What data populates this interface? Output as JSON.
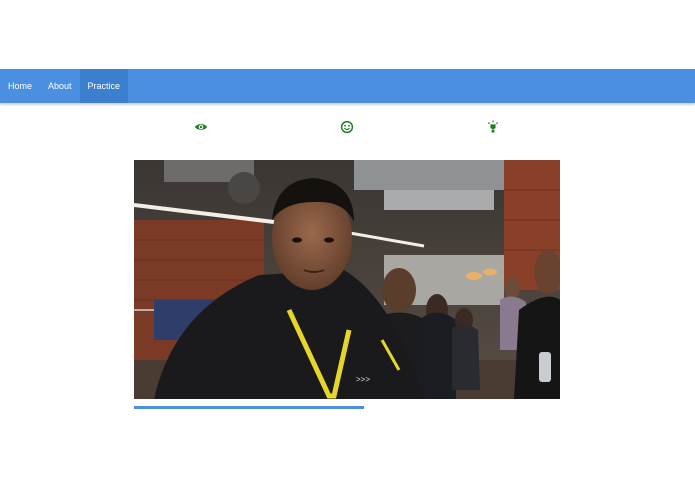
{
  "nav": {
    "items": [
      {
        "label": "Home",
        "active": false
      },
      {
        "label": "About",
        "active": false
      },
      {
        "label": "Practice",
        "active": true
      }
    ]
  },
  "toolbar": {
    "icons": [
      {
        "name": "eye-icon"
      },
      {
        "name": "smiley-icon"
      },
      {
        "name": "lightbulb-icon"
      }
    ],
    "icon_color": "#1e7d24"
  },
  "colors": {
    "nav_bg": "#4a8fe0",
    "nav_active_bg": "#3b7fcf",
    "progress": "#4a8fe0"
  },
  "progress": {
    "fraction": 0.54
  }
}
